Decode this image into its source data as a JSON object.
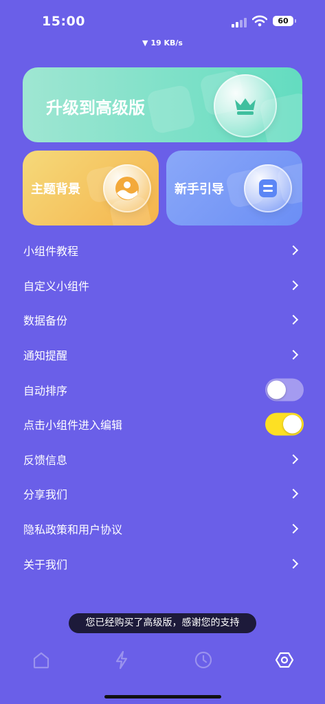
{
  "status_bar": {
    "time": "15:00",
    "battery": "60",
    "net_speed": "▼ 19 KB/s"
  },
  "cards": {
    "upgrade": {
      "title": "升级到高级版",
      "icon": "crown-icon"
    },
    "theme": {
      "title": "主题背景",
      "icon": "sunset-icon"
    },
    "guide": {
      "title": "新手引导",
      "icon": "guide-icon"
    }
  },
  "menu": {
    "items": [
      {
        "label": "小组件教程"
      },
      {
        "label": "自定义小组件"
      },
      {
        "label": "数据备份"
      },
      {
        "label": "通知提醒"
      },
      {
        "label": "自动排序",
        "toggle": false
      },
      {
        "label": "点击小组件进入编辑",
        "toggle": true
      },
      {
        "label": "反馈信息"
      },
      {
        "label": "分享我们"
      },
      {
        "label": "隐私政策和用户协议"
      },
      {
        "label": "关于我们"
      }
    ]
  },
  "toast": {
    "text": "您已经购买了高级版，感谢您的支持"
  },
  "tabbar": {
    "tabs": [
      {
        "icon": "home-icon"
      },
      {
        "icon": "lightning-icon"
      },
      {
        "icon": "clock-icon"
      },
      {
        "icon": "settings-hexagon-icon",
        "active": true
      }
    ]
  },
  "colors": {
    "background": "#6a5fe8",
    "upgrade_card": "#63dcc0",
    "theme_card": "#f5b44c",
    "guide_card": "#6b8ef5",
    "toggle_on": "#fde023",
    "toggle_off": "#a49bf0"
  }
}
